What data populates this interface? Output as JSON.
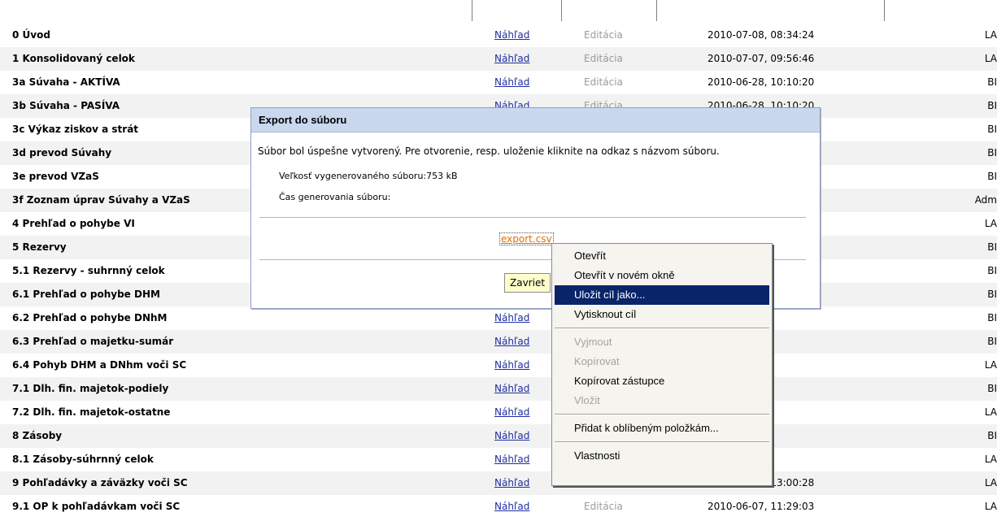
{
  "table": {
    "rows": [
      {
        "name": "0 Úvod",
        "preview": "Náhľad",
        "edit": "Editácia",
        "date": "2010-07-08, 08:34:24",
        "user": "LA"
      },
      {
        "name": "1 Konsolidovaný celok",
        "preview": "Náhľad",
        "edit": "Editácia",
        "date": "2010-07-07, 09:56:46",
        "user": "LA"
      },
      {
        "name": "3a Súvaha - AKTÍVA",
        "preview": "Náhľad",
        "edit": "Editácia",
        "date": "2010-06-28, 10:10:20",
        "user": "BI"
      },
      {
        "name": "3b Súvaha - PASÍVA",
        "preview": "Náhľad",
        "edit": "Editácia",
        "date": "2010-06-28, 10:10:20",
        "user": "BI"
      },
      {
        "name": "3c Výkaz ziskov a strát",
        "preview": "",
        "edit": "",
        "date": "20",
        "user": "BI"
      },
      {
        "name": "3d prevod Súvahy",
        "preview": "",
        "edit": "",
        "date": "20",
        "user": "BI"
      },
      {
        "name": "3e prevod VZaS",
        "preview": "",
        "edit": "",
        "date": "20",
        "user": "BI"
      },
      {
        "name": "3f Zoznam úprav Súvahy a VZaS",
        "preview": "",
        "edit": "",
        "date": "23",
        "user": "Adm"
      },
      {
        "name": "4 Prehľad o pohybe VI",
        "preview": "",
        "edit": "",
        "date": "28",
        "user": "LA"
      },
      {
        "name": "5 Rezervy",
        "preview": "",
        "edit": "",
        "date": "20",
        "user": "BI"
      },
      {
        "name": "5.1 Rezervy - suhrnný celok",
        "preview": "",
        "edit": "",
        "date": "20",
        "user": "BI"
      },
      {
        "name": "6.1 Prehľad o pohybe DHM",
        "preview": "",
        "edit": "",
        "date": "20",
        "user": "BI"
      },
      {
        "name": "6.2 Prehľad o pohybe DNhM",
        "preview": "Náhľad",
        "edit": "",
        "date": ", 10:10:20",
        "user": "BI"
      },
      {
        "name": "6.3 Prehľad o majetku-sumár",
        "preview": "Náhľad",
        "edit": "",
        "date": ", 10:10:20",
        "user": "BI"
      },
      {
        "name": "6.4 Pohyb DHM a DNhm voči SC",
        "preview": "Náhľad",
        "edit": "",
        "date": ", 11:29:03",
        "user": "LA"
      },
      {
        "name": "7.1 Dlh. fin. majetok-podiely",
        "preview": "Náhľad",
        "edit": "",
        "date": ", 10:10:20",
        "user": "BI"
      },
      {
        "name": "7.2 Dlh. fin. majetok-ostatne",
        "preview": "Náhľad",
        "edit": "",
        "date": ", 09:56:46",
        "user": "LA"
      },
      {
        "name": "8 Zásoby",
        "preview": "Náhľad",
        "edit": "",
        "date": ", 10:10:20",
        "user": "BI"
      },
      {
        "name": "8.1 Zásoby-súhrnný celok",
        "preview": "Náhľad",
        "edit": "",
        "date": ", 11:29:03",
        "user": "LA"
      },
      {
        "name": "9 Pohľadávky a záväzky voči SC",
        "preview": "Náhľad",
        "edit": "Editácia",
        "date": "2010-07-07, 13:00:28",
        "user": "LA"
      },
      {
        "name": "9.1 OP k pohľadávkam voči SC",
        "preview": "Náhľad",
        "edit": "Editácia",
        "date": "2010-06-07, 11:29:03",
        "user": "LA"
      }
    ]
  },
  "dialog": {
    "title": "Export do súboru",
    "message": "Súbor bol úspešne vytvorený. Pre otvorenie, resp. uloženie kliknite na odkaz s názvom súboru.",
    "size_label": "Veľkosť vygenerovaného súboru:753 kB",
    "time_label": "Čas generovania súboru:",
    "file_link": "export.csv",
    "close_button": "Zavriet"
  },
  "context_menu": {
    "items": [
      {
        "label": "Otevřít",
        "disabled": false,
        "selected": false
      },
      {
        "label": "Otevřít v novém okně",
        "disabled": false,
        "selected": false
      },
      {
        "label": "Uložit cíl jako...",
        "disabled": false,
        "selected": true
      },
      {
        "label": "Vytisknout cíl",
        "disabled": false,
        "selected": false
      },
      {
        "separator": true
      },
      {
        "label": "Vyjmout",
        "disabled": true,
        "selected": false
      },
      {
        "label": "Kopírovat",
        "disabled": true,
        "selected": false
      },
      {
        "label": "Kopírovat zástupce",
        "disabled": false,
        "selected": false
      },
      {
        "label": "Vložit",
        "disabled": true,
        "selected": false
      },
      {
        "separator": true
      },
      {
        "label": "Přidat k oblíbeným položkám...",
        "disabled": false,
        "selected": false
      },
      {
        "separator": true
      },
      {
        "label": "Vlastnosti",
        "disabled": false,
        "selected": false
      }
    ]
  },
  "colors": {
    "link": "#1f2fa0",
    "muted": "#9a9a9a",
    "dialog_title_bg": "#c9d8ee",
    "menu_selection": "#0a246a",
    "file_link": "#e07000",
    "button_bg": "#ffffcc"
  }
}
